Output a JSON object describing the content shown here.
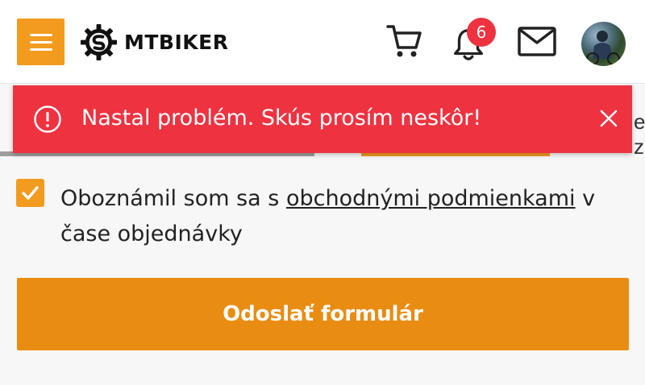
{
  "header": {
    "brand": "MTBIKER",
    "notification_count": "6"
  },
  "toast": {
    "message": "Nastal problém. Skús prosím neskôr!"
  },
  "background": {
    "partial_text": "e z"
  },
  "form": {
    "checkbox_checked": true,
    "terms_before": "Oboznámil som sa s ",
    "terms_link": "obchodnými podmienkami",
    "terms_after": " v čase objednávky",
    "submit_label": "Odoslať formulár"
  },
  "colors": {
    "accent": "#f39b1f",
    "error": "#ee3240",
    "submit": "#e98c12"
  }
}
